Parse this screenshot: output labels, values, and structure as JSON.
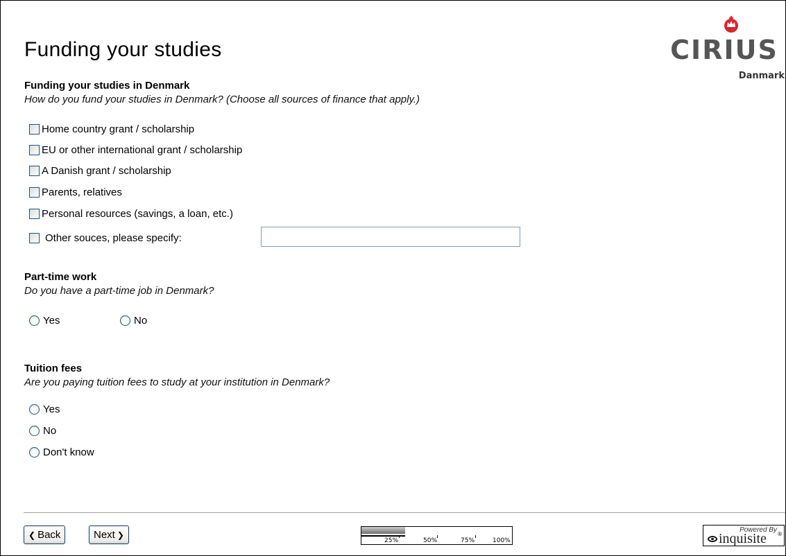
{
  "page": {
    "title": "Funding your studies"
  },
  "logo": {
    "brand": "CIRIUS",
    "country": "Danmark",
    "crown_color": "#d9232e"
  },
  "funding": {
    "heading": "Funding your studies in Denmark",
    "question": "How do you fund your studies in Denmark? (Choose all sources of finance that apply.)",
    "options": [
      "Home country grant / scholarship",
      "EU or other international grant / scholarship",
      "A Danish grant / scholarship",
      "Parents, relatives",
      "Personal resources (savings, a loan, etc.)"
    ],
    "other_label": "Other souces, please specify:",
    "other_value": ""
  },
  "parttime": {
    "heading": "Part-time work",
    "question": "Do you have a part-time job in Denmark?",
    "options": [
      "Yes",
      "No"
    ]
  },
  "tuition": {
    "heading": "Tuition fees",
    "question": "Are you paying tuition fees to study at your institution in Denmark?",
    "options": [
      "Yes",
      "No",
      "Don't know"
    ]
  },
  "nav": {
    "back_label": "Back",
    "next_label": "Next"
  },
  "progress": {
    "labels": [
      "25%",
      "50%",
      "75%",
      "100%"
    ],
    "filled_fraction": 0.29
  },
  "powered": {
    "small": "Powered By",
    "brand": "inquisite",
    "reg": "®"
  }
}
